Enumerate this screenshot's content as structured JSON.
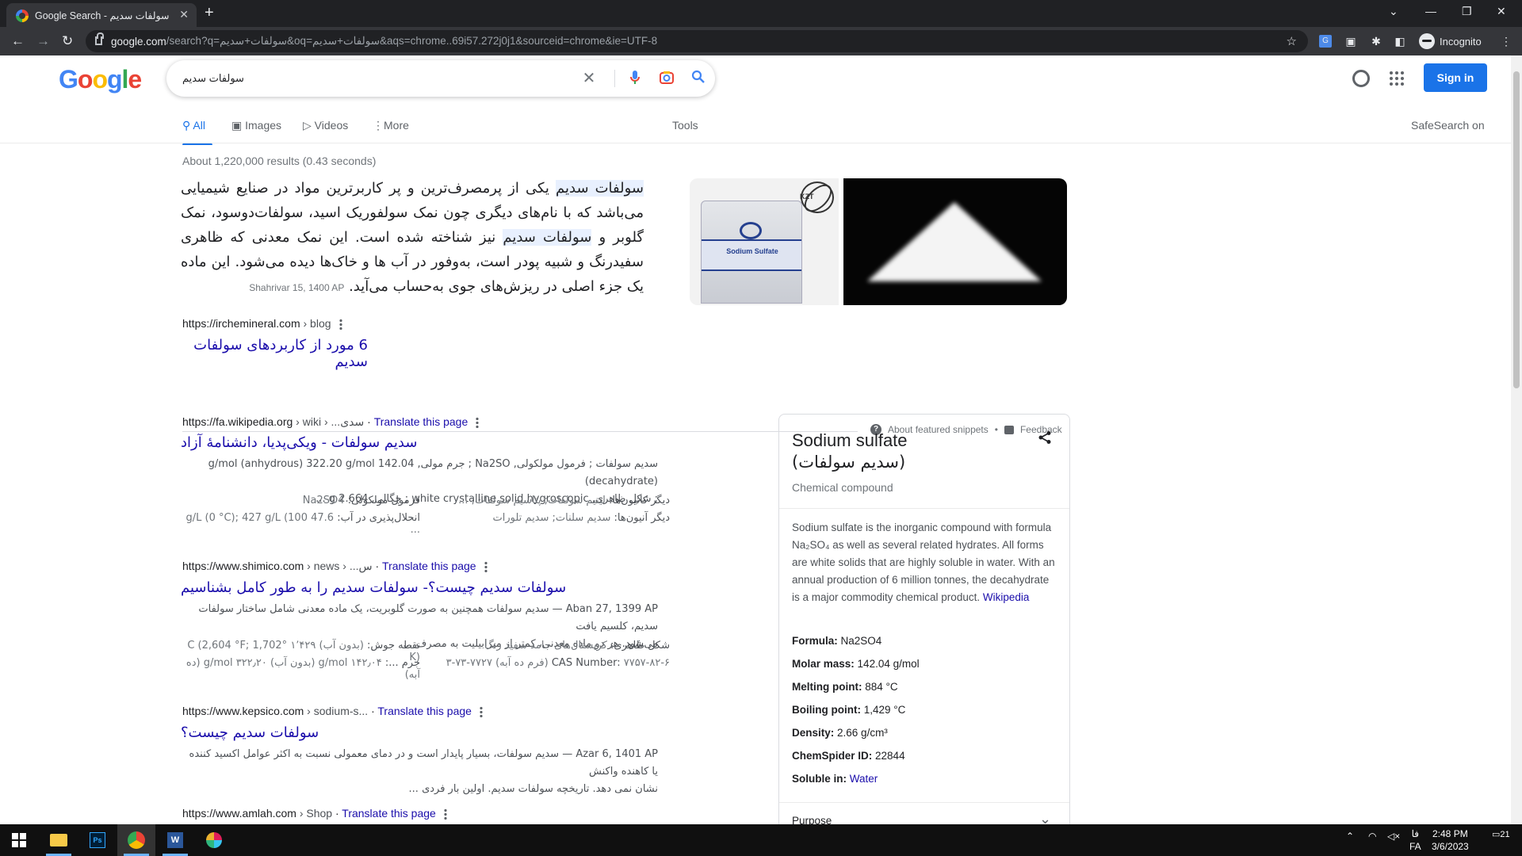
{
  "browser": {
    "tab_title": "Google Search - سولفات سدیم",
    "url_host": "google.com",
    "url_rest": "/search?q=سولفات+سدیم&oq=سولفات+سدیم&aqs=chrome..69i57.272j0j1&sourceid=chrome&ie=UTF-8",
    "incognito_label": "Incognito"
  },
  "header": {
    "logo": "Google",
    "query": "سولفات سدیم",
    "sign_in": "Sign in"
  },
  "tabs": {
    "all": "All",
    "images": "Images",
    "videos": "Videos",
    "more": "More",
    "tools": "Tools",
    "safesearch": "SafeSearch on"
  },
  "stats": "About 1,220,000 results (0.43 seconds)",
  "featured": {
    "hl1": "سولفات سدیم",
    "text1": " یکی از پرمصرف‌ترین و پر کاربرترین مواد در صنایع شیمیایی می‌باشد که با نام‌های دیگری چون نمک سولفوریک اسید، سولفات‌دو‌سود، نمک گلوبر و ",
    "hl2": "سولفات سدیم",
    "text2": " نیز شناخته شده است. این نمک معدنی که ظاهری سفیدرنگ و شبیه پودر است، به‌وفور در آب ها و خاک‌ها دیده می‌شود. این ماده یک جزء اصلی در ریزش‌های جوی به‌حساب می‌آید.",
    "date": "Shahrivar 15, 1400 AP",
    "bag_label": "Sodium Sulfate",
    "atom_label": "KZT",
    "url": "https://irchemineral.com",
    "crumb": " › blog",
    "title": "6 مورد از کاربردهای سولفات سدیم",
    "about": "About featured snippets",
    "sep": "•",
    "feedback": "Feedback"
  },
  "results": [
    {
      "url": "https://fa.wikipedia.org",
      "crumb": " › wiki › ...سدی",
      "translate": "Translate this page",
      "title": "سدیم سولفات - ویکی‌پدیا، دانشنامهٔ آزاد",
      "desc1": "سدیم سولفات ; فرمول مولکولی, Na2SO ; جرم مولی, 142.04 g/mol (anhydrous) 322.20 g/mol (decahydrate)",
      "desc2": "; شکل ظاهری, white crystalline solid hygroscopic ; چگالی, 2.664 g ...",
      "attrs": [
        {
          "k": "فرمول مولکولی: ",
          "v": "Na2SO4"
        },
        {
          "k": "دیگر کاتیون‌ها: ",
          "v": "لیتیم سولفات; پتاسیم سولفات; ..."
        },
        {
          "k": "انحلال‌پذیری در آب: ",
          "v": "47.6 g/L (0 °C); 427 g/L (100 ..."
        },
        {
          "k": "دیگر آنیون‌ها: ",
          "v": "سدیم سلنات; سدیم تلورات"
        }
      ]
    },
    {
      "url": "https://www.shimico.com",
      "crumb": " › news › ...س",
      "translate": "Translate this page",
      "title": "سولفات سدیم چیست؟- سولفات سدیم را به طور کامل بشناسیم",
      "desc1": "Aban 27, 1399 AP — سدیم سولفات همچنین به صورت گلوبریت، یک ماده معدنی شامل ساختار سولفات سدیم، کلسیم یافت",
      "desc2": "می‌شود. هر دو ماده معدنی، کمتر از میرابیلیت به مصرف ...",
      "attrs": [
        {
          "k": "نقطه جوش: ",
          "v": "(بدون آب) ۱٬۴۲۹ °C (2,604 °F; 1,702 K)"
        },
        {
          "k": "شکل ظاهری: ",
          "v": "کریستال‌های جامد سفید رنگ"
        },
        {
          "k": "جرم ...: ",
          "v": "۱۴۲٫۰۴ g/mol (بدون آب) ۳۲۲٫۲۰ g/mol (ده آبه)"
        },
        {
          "k": "CAS Number: ",
          "v": "۷۷۵۷-۸۲-۶ (فرم ده آبه) ۷۷۲۷-۷۳-۳"
        }
      ]
    },
    {
      "url": "https://www.kepsico.com",
      "crumb": " › sodium-s...",
      "translate": "Translate this page",
      "title": "سولفات سدیم چیست؟",
      "desc1": "Azar 6, 1401 AP — سدیم سولفات، بسیار پایدار است و در دمای معمولی نسبت به اکثر عوامل اکسید کننده یا کاهنده واکنش",
      "desc2": "نشان نمی دهد. تاریخچه سولفات سدیم. اولین بار فردی ..."
    },
    {
      "url": "https://www.amlah.com",
      "crumb": " › Shop",
      "translate": "Translate this page"
    }
  ],
  "knowledge_panel": {
    "title": "Sodium sulfate",
    "subtitle": "(سدیم سولفات)",
    "type": "Chemical compound",
    "description": "Sodium sulfate is the inorganic compound with formula Na₂SO₄ as well as several related hydrates. All forms are white solids that are highly soluble in water. With an annual production of 6 million tonnes, the decahydrate is a major commodity chemical product.",
    "source": "Wikipedia",
    "facts": [
      {
        "label": "Formula:",
        "value": "Na2SO4"
      },
      {
        "label": "Molar mass:",
        "value": "142.04 g/mol"
      },
      {
        "label": "Melting point:",
        "value": "884 °C"
      },
      {
        "label": "Boiling point:",
        "value": "1,429 °C"
      },
      {
        "label": "Density:",
        "value": "2.66 g/cm³"
      },
      {
        "label": "ChemSpider ID:",
        "value": "22844"
      },
      {
        "label": "Soluble in:",
        "value": "Water"
      }
    ],
    "purpose": "Purpose"
  },
  "taskbar": {
    "time": "2:48 PM",
    "date": "3/6/2023",
    "lang1": "فا",
    "lang2": "FA",
    "notif": "21"
  },
  "colors": {
    "accent": "#1a73e8",
    "link": "#1a0dab",
    "chrome_dark": "#202124"
  }
}
